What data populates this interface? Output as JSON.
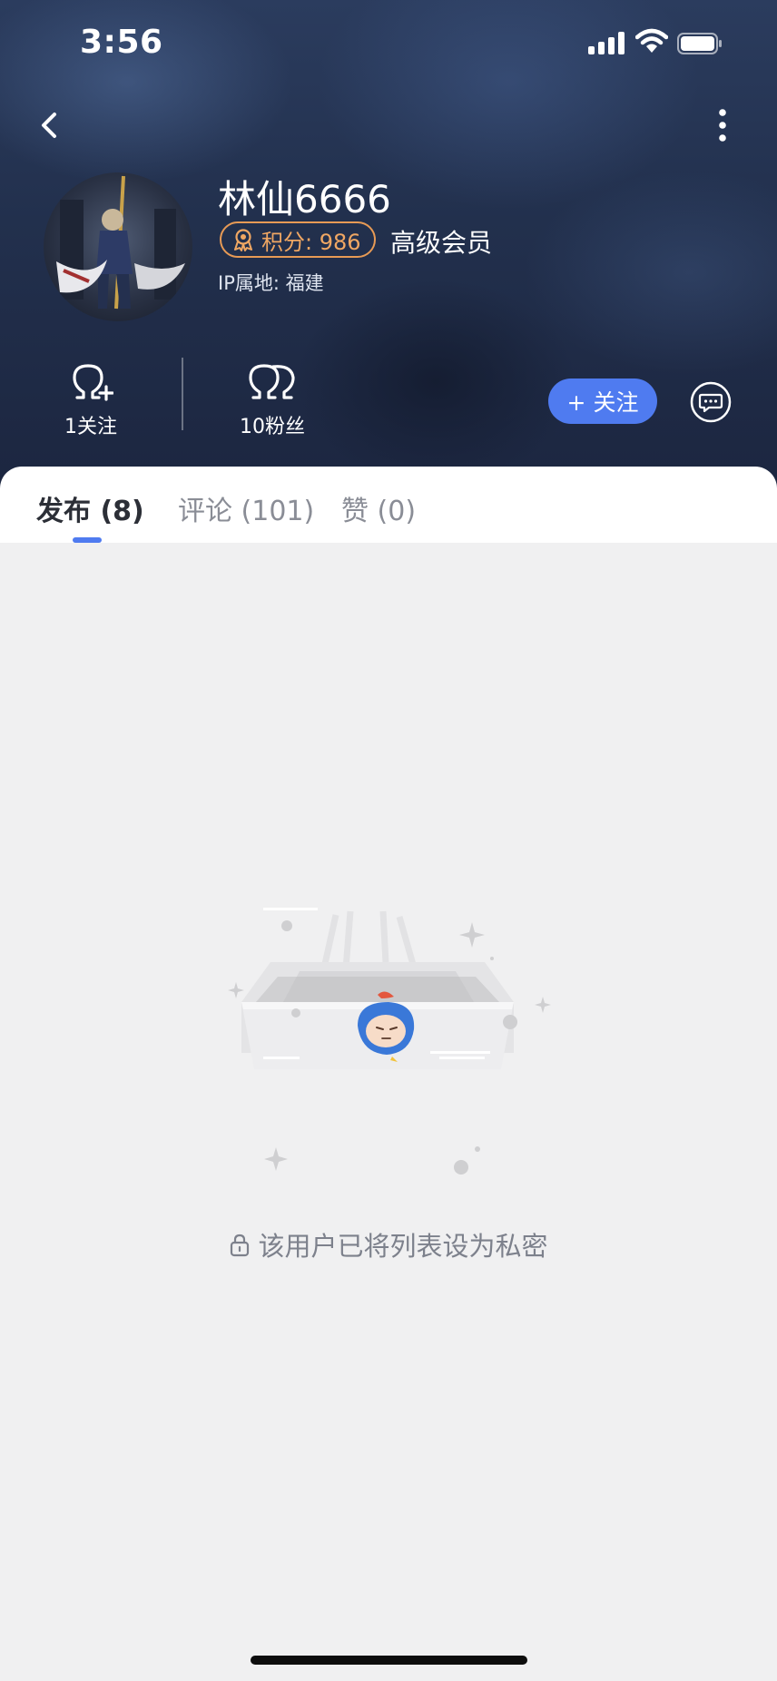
{
  "status_bar": {
    "time": "3:56"
  },
  "profile": {
    "username": "林仙6666",
    "points_label": "积分: 986",
    "member_level": "高级会员",
    "ip_location": "IP属地:  福建"
  },
  "stats": {
    "following_label": "1关注",
    "followers_label": "10粉丝"
  },
  "actions": {
    "follow_label": "+ 关注"
  },
  "tabs": [
    {
      "label": "发布 (8)",
      "active": true
    },
    {
      "label": "评论 (101)",
      "active": false
    },
    {
      "label": "赞 (0)",
      "active": false
    }
  ],
  "empty_state": {
    "message": "该用户已将列表设为私密"
  },
  "colors": {
    "accent": "#4f7bf0",
    "points_orange": "#f0a763",
    "header_bg": "#22304d",
    "page_bg": "#f0f0f1"
  },
  "icons": [
    "back-icon",
    "more-icon",
    "points-medal-icon",
    "follow-person-icon",
    "followers-icon",
    "message-icon",
    "lock-icon",
    "signal-icon",
    "wifi-icon",
    "battery-icon"
  ]
}
